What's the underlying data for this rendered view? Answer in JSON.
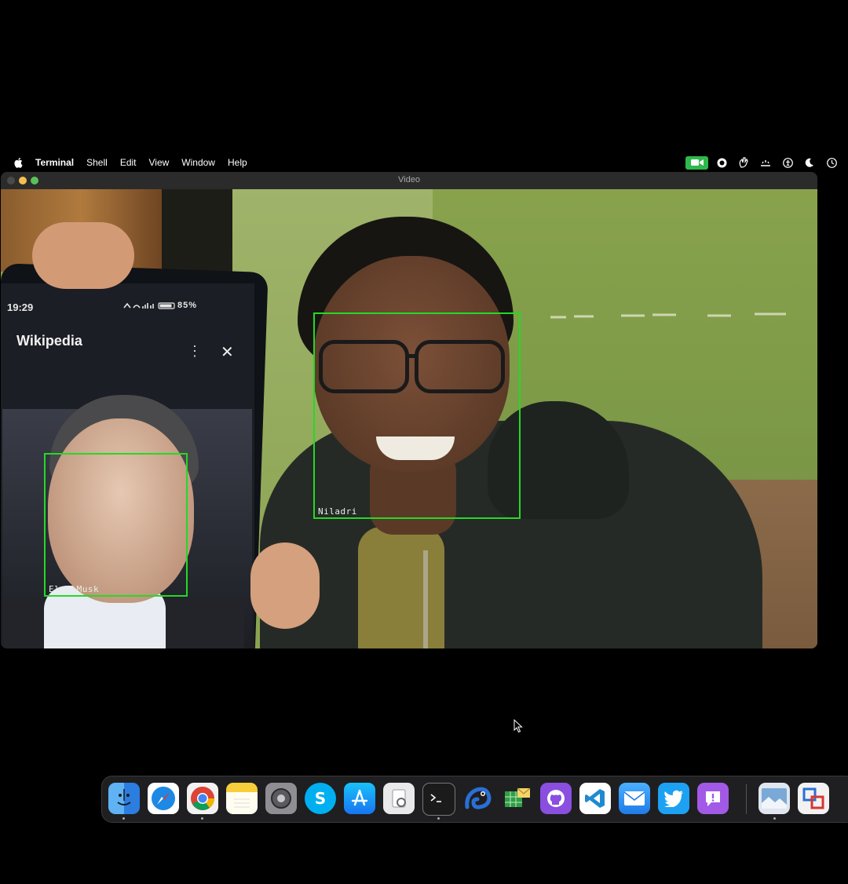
{
  "menubar": {
    "app_name": "Terminal",
    "items": [
      "Shell",
      "Edit",
      "View",
      "Window",
      "Help"
    ],
    "status_icons": [
      "zoom-camera-icon",
      "record-icon",
      "hand-icon",
      "sparkle-icon",
      "accessibility-icon",
      "moon-icon",
      "clock-icon"
    ]
  },
  "window": {
    "title": "Video"
  },
  "phone": {
    "time": "19:29",
    "status": "85%",
    "app_title": "Wikipedia",
    "more_icon": "⋮",
    "close_icon": "✕"
  },
  "detections": [
    {
      "label": "Elon Musk"
    },
    {
      "label": "Niladri"
    }
  ],
  "colors": {
    "detection_box": "#25d925",
    "camera_indicator": "#2fb84c"
  },
  "dock": {
    "apps": [
      {
        "name": "finder-icon",
        "running": true
      },
      {
        "name": "safari-icon",
        "running": false
      },
      {
        "name": "chrome-icon",
        "running": true
      },
      {
        "name": "notes-icon",
        "running": false
      },
      {
        "name": "system-settings-icon",
        "running": false
      },
      {
        "name": "skype-icon",
        "running": false
      },
      {
        "name": "app-store-icon",
        "running": false
      },
      {
        "name": "preview-icon",
        "running": false
      },
      {
        "name": "terminal-icon",
        "running": true
      },
      {
        "name": "chameleon-icon",
        "running": false
      },
      {
        "name": "mail-spreadsheet-icon",
        "running": false
      },
      {
        "name": "github-icon",
        "running": false
      },
      {
        "name": "vscode-icon",
        "running": false
      },
      {
        "name": "mail-icon",
        "running": false
      },
      {
        "name": "twitter-icon",
        "running": false
      },
      {
        "name": "feedback-icon",
        "running": false
      },
      {
        "name": "preview-image-icon",
        "running": true
      },
      {
        "name": "parallels-icon",
        "running": false
      }
    ]
  }
}
